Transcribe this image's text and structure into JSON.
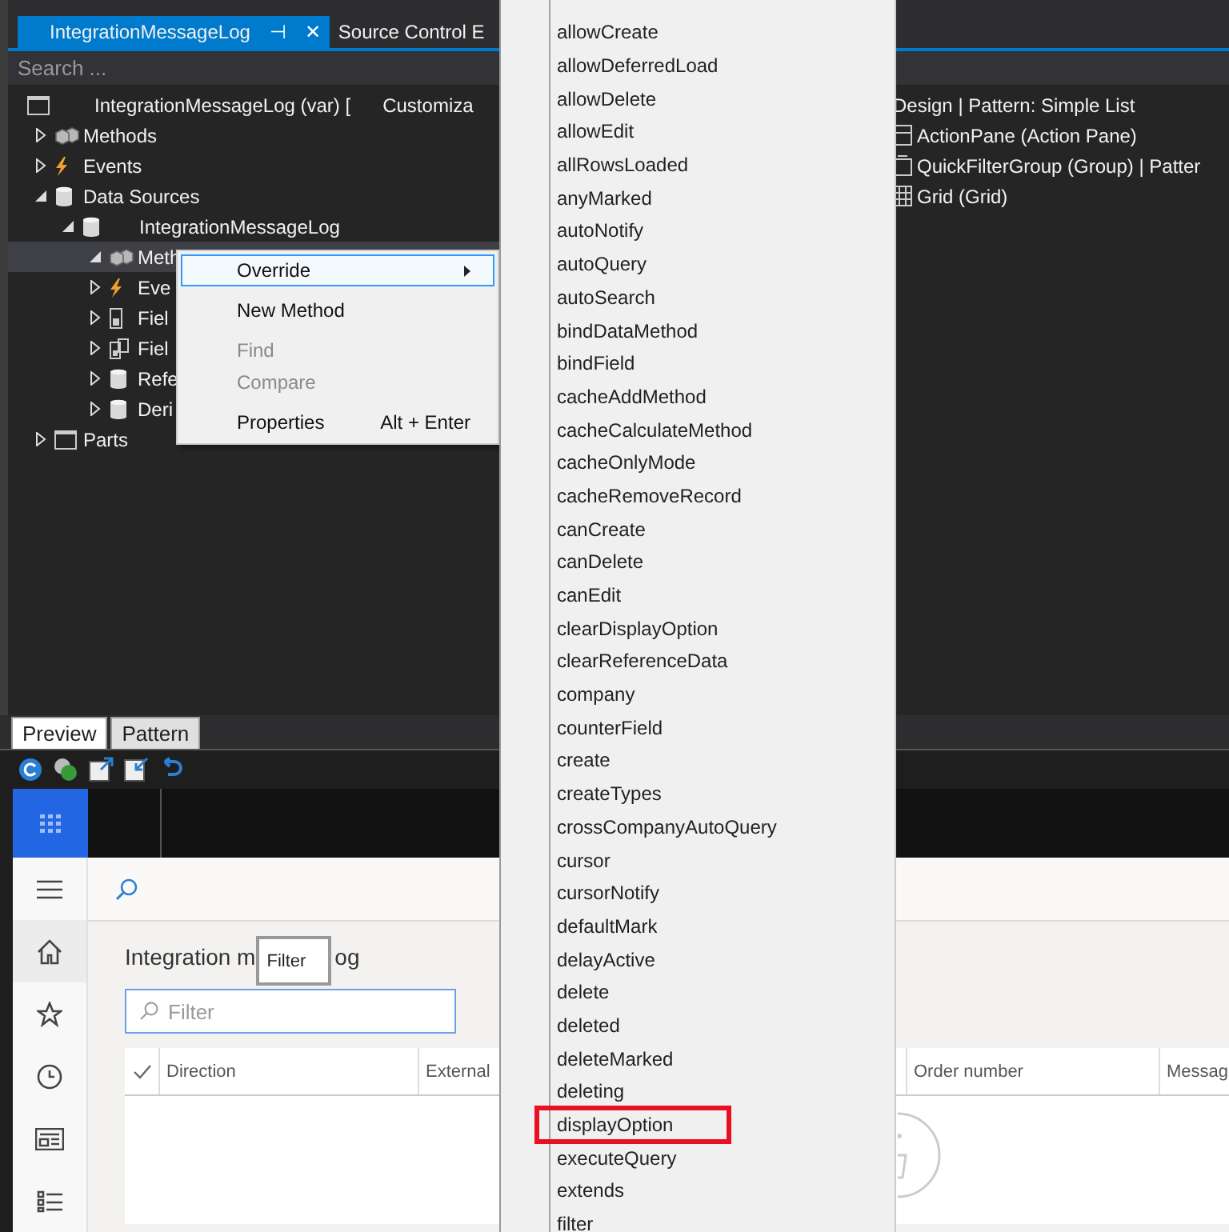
{
  "document_tabs": [
    {
      "label": "IntegrationMessageLog",
      "selected": true,
      "pin": "⊣",
      "close": "✕"
    },
    {
      "label": "Source Control E",
      "selected": false
    }
  ],
  "search": {
    "placeholder": "Search ..."
  },
  "tree": {
    "root": {
      "label": "IntegrationMessageLog (var) [",
      "note": "Customiza",
      "kind": "window"
    },
    "items": [
      {
        "label": "Methods",
        "kind": "methods",
        "expanded": false,
        "selected": false
      },
      {
        "label": "Events",
        "kind": "events",
        "expanded": false,
        "selected": false
      },
      {
        "label": "Data Sources",
        "kind": "datasource",
        "expanded": true,
        "selected": false,
        "children": [
          {
            "label": "IntegrationMessageLog",
            "kind": "datasource",
            "expanded": true,
            "selected": false,
            "children": [
              {
                "label": "Meth",
                "kind": "methods",
                "expanded": true,
                "selected": true
              },
              {
                "label": "Eve",
                "kind": "events",
                "expanded": false,
                "selected": false
              },
              {
                "label": "Fiel",
                "kind": "field",
                "expanded": false,
                "selected": false
              },
              {
                "label": "Fiel",
                "kind": "fieldgroup",
                "expanded": false,
                "selected": false
              },
              {
                "label": "Refe",
                "kind": "datasource",
                "expanded": false,
                "selected": false
              },
              {
                "label": "Deri",
                "kind": "datasource",
                "expanded": false,
                "selected": false
              }
            ]
          }
        ]
      },
      {
        "label": "Parts",
        "kind": "window",
        "expanded": false,
        "selected": false
      }
    ]
  },
  "design_tree": {
    "header": "Design | Pattern: Simple List",
    "items": [
      {
        "label": "ActionPane (Action Pane)",
        "kind": "pane"
      },
      {
        "label": "QuickFilterGroup (Group) | Patter",
        "kind": "group"
      },
      {
        "label": "Grid (Grid)",
        "kind": "grid"
      }
    ]
  },
  "context_menu": [
    {
      "label": "Override",
      "kind": "submenu",
      "highlighted": true,
      "disabled": false,
      "separator_before": false
    },
    {
      "label": "New Method",
      "kind": "item",
      "highlighted": false,
      "disabled": false,
      "separator_before": true
    },
    {
      "label": "Find",
      "kind": "item",
      "highlighted": false,
      "disabled": true,
      "separator_before": true
    },
    {
      "label": "Compare",
      "kind": "item",
      "highlighted": false,
      "disabled": true,
      "separator_before": false
    },
    {
      "label": "Properties",
      "kind": "item",
      "shortcut": "Alt + Enter",
      "highlighted": false,
      "disabled": false,
      "separator_before": true
    }
  ],
  "submenu": [
    {
      "label": "allowCreate",
      "marked": false
    },
    {
      "label": "allowDeferredLoad",
      "marked": false
    },
    {
      "label": "allowDelete",
      "marked": false
    },
    {
      "label": "allowEdit",
      "marked": false
    },
    {
      "label": "allRowsLoaded",
      "marked": false
    },
    {
      "label": "anyMarked",
      "marked": false
    },
    {
      "label": "autoNotify",
      "marked": false
    },
    {
      "label": "autoQuery",
      "marked": false
    },
    {
      "label": "autoSearch",
      "marked": false
    },
    {
      "label": "bindDataMethod",
      "marked": false
    },
    {
      "label": "bindField",
      "marked": false
    },
    {
      "label": "cacheAddMethod",
      "marked": false
    },
    {
      "label": "cacheCalculateMethod",
      "marked": false
    },
    {
      "label": "cacheOnlyMode",
      "marked": false
    },
    {
      "label": "cacheRemoveRecord",
      "marked": false
    },
    {
      "label": "canCreate",
      "marked": false
    },
    {
      "label": "canDelete",
      "marked": false
    },
    {
      "label": "canEdit",
      "marked": false
    },
    {
      "label": "clearDisplayOption",
      "marked": false
    },
    {
      "label": "clearReferenceData",
      "marked": false
    },
    {
      "label": "company",
      "marked": false
    },
    {
      "label": "counterField",
      "marked": false
    },
    {
      "label": "create",
      "marked": false
    },
    {
      "label": "createTypes",
      "marked": false
    },
    {
      "label": "crossCompanyAutoQuery",
      "marked": false
    },
    {
      "label": "cursor",
      "marked": false
    },
    {
      "label": "cursorNotify",
      "marked": false
    },
    {
      "label": "defaultMark",
      "marked": false
    },
    {
      "label": "delayActive",
      "marked": false
    },
    {
      "label": "delete",
      "marked": false
    },
    {
      "label": "deleted",
      "marked": false
    },
    {
      "label": "deleteMarked",
      "marked": false
    },
    {
      "label": "deleting",
      "marked": false
    },
    {
      "label": "displayOption",
      "marked": true
    },
    {
      "label": "executeQuery",
      "marked": false
    },
    {
      "label": "extends",
      "marked": false
    },
    {
      "label": "filter",
      "marked": false
    }
  ],
  "preview_tabs": [
    {
      "label": "Preview",
      "selected": true
    },
    {
      "label": "Pattern",
      "selected": false
    }
  ],
  "preview": {
    "nav": [
      {
        "kind": "menu",
        "selected": false
      },
      {
        "kind": "home",
        "selected": true
      },
      {
        "kind": "star",
        "selected": false
      },
      {
        "kind": "clock",
        "selected": false
      },
      {
        "kind": "workspace",
        "selected": false
      },
      {
        "kind": "list",
        "selected": false
      }
    ],
    "title_start": "Integration m",
    "title_end": "og",
    "tooltip": "Filter",
    "filter": {
      "placeholder": "Filter"
    },
    "columns": [
      "Direction",
      "External",
      "Order number",
      "Messag"
    ]
  }
}
